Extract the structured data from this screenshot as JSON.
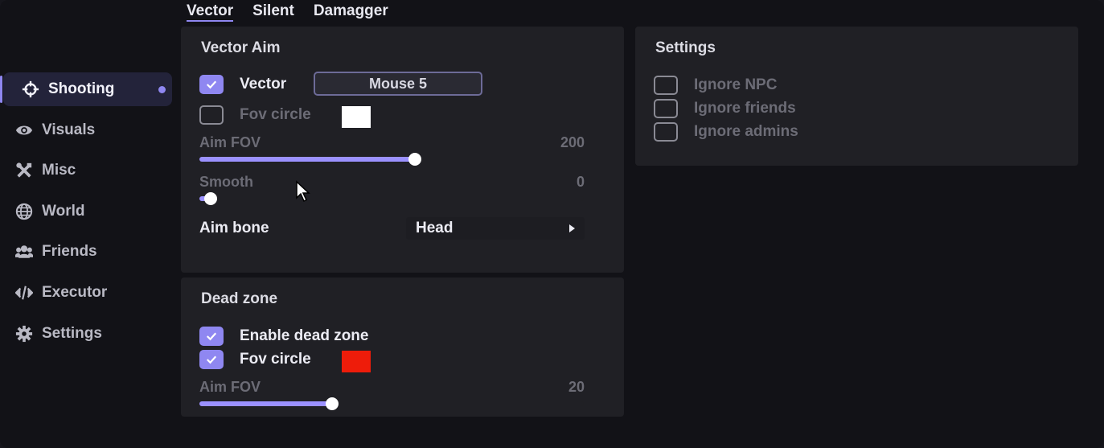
{
  "tabs": [
    {
      "label": "Vector",
      "active": true
    },
    {
      "label": "Silent",
      "active": false
    },
    {
      "label": "Damagger",
      "active": false
    }
  ],
  "sidebar": {
    "items": [
      {
        "label": "Shooting",
        "icon": "crosshair-icon",
        "active": true
      },
      {
        "label": "Visuals",
        "icon": "eye-icon",
        "active": false
      },
      {
        "label": "Misc",
        "icon": "tools-icon",
        "active": false
      },
      {
        "label": "World",
        "icon": "globe-icon",
        "active": false
      },
      {
        "label": "Friends",
        "icon": "users-icon",
        "active": false
      },
      {
        "label": "Executor",
        "icon": "code-icon",
        "active": false
      },
      {
        "label": "Settings",
        "icon": "gear-icon",
        "active": false
      }
    ]
  },
  "vector_aim": {
    "title": "Vector Aim",
    "vector": {
      "label": "Vector",
      "checked": true,
      "keybind": "Mouse 5"
    },
    "fov_circle": {
      "label": "Fov circle",
      "checked": false,
      "color": "#ffffff"
    },
    "aim_fov": {
      "label": "Aim FOV",
      "value": "200",
      "fill_fraction": 0.56
    },
    "smooth": {
      "label": "Smooth",
      "value": "0",
      "fill_fraction": 0.03
    },
    "aim_bone": {
      "label": "Aim bone",
      "value": "Head"
    }
  },
  "dead_zone": {
    "title": "Dead zone",
    "enable": {
      "label": "Enable dead zone",
      "checked": true
    },
    "fov_circle": {
      "label": "Fov circle",
      "checked": true,
      "color": "#ee1c0a"
    },
    "aim_fov": {
      "label": "Aim FOV",
      "value": "20",
      "fill_fraction": 0.345
    }
  },
  "settings": {
    "title": "Settings",
    "options": [
      {
        "label": "Ignore NPC",
        "checked": false
      },
      {
        "label": "Ignore friends",
        "checked": false
      },
      {
        "label": "Ignore admins",
        "checked": false
      }
    ]
  },
  "colors": {
    "accent": "#8f87f1",
    "slider_fill": "#9b91ff",
    "panel_bg": "#202025",
    "window_bg": "#121217"
  }
}
